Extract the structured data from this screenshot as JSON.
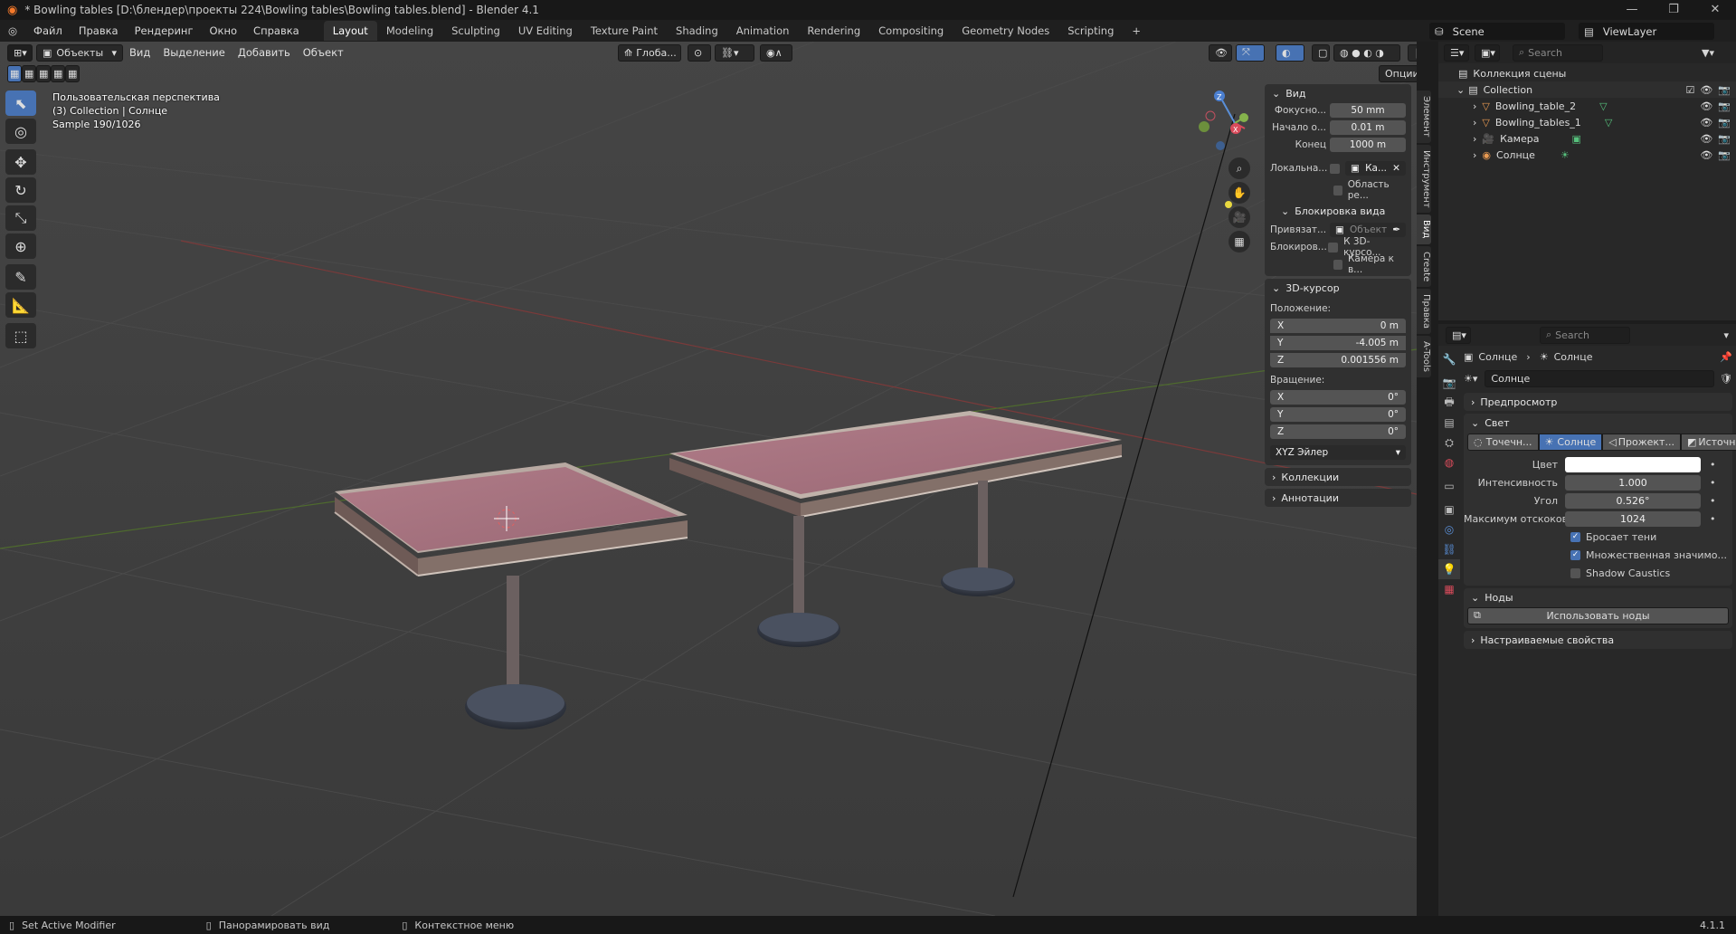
{
  "window": {
    "title": "* Bowling tables [D:\\блендер\\проекты 224\\Bowling tables\\Bowling tables.blend] - Blender 4.1"
  },
  "menu": [
    "Файл",
    "Правка",
    "Рендеринг",
    "Окно",
    "Справка"
  ],
  "workspaces": [
    "Layout",
    "Modeling",
    "Sculpting",
    "UV Editing",
    "Texture Paint",
    "Shading",
    "Animation",
    "Rendering",
    "Compositing",
    "Geometry Nodes",
    "Scripting"
  ],
  "active_workspace": "Layout",
  "scene": {
    "name": "Scene",
    "view_layer": "ViewLayer"
  },
  "viewport_header": {
    "mode": "Объекты",
    "menus": [
      "Вид",
      "Выделение",
      "Добавить",
      "Объект"
    ],
    "transform_orientation": "Глоба...",
    "options_label": "Опции"
  },
  "viewport_info": {
    "line1": "Пользовательская перспектива",
    "line2": "(3) Collection | Солнце",
    "line3": "Sample 190/1026"
  },
  "npanel": {
    "view": {
      "header": "Вид",
      "focal_label": "Фокусно...",
      "focal_value": "50 mm",
      "clip_start_label": "Начало о...",
      "clip_start_value": "0.01 m",
      "clip_end_label": "Конец",
      "clip_end_value": "1000 m",
      "local_camera_label": "Локальна...",
      "local_camera_value": "Ка...",
      "render_region_label": "Область ре...",
      "view_lock_header": "Блокировка вида",
      "lock_to_label": "Привязат...",
      "lock_to_value": "Объект",
      "lock_label": "Блокиров...",
      "lock_cursor_label": "К 3D-курсо...",
      "lock_camera_label": "Камера к в..."
    },
    "cursor": {
      "header": "3D-курсор",
      "location_label": "Положение:",
      "x_label": "X",
      "x": "0 m",
      "y_label": "Y",
      "y": "-4.005 m",
      "z_label": "Z",
      "z": "0.001556 m",
      "rotation_label": "Вращение:",
      "rx_label": "X",
      "rx": "0°",
      "ry_label": "Y",
      "ry": "0°",
      "rz_label": "Z",
      "rz": "0°",
      "rotation_mode": "XYZ Эйлер"
    },
    "collections_header": "Коллекции",
    "annotations_header": "Аннотации",
    "side_tabs": [
      "Элемент",
      "Инструмент",
      "Вид",
      "Create",
      "Правка",
      "A-Tools"
    ]
  },
  "outliner": {
    "search_placeholder": "Search",
    "root": "Коллекция сцены",
    "collection": "Collection",
    "items": [
      "Bowling_table_2",
      "Bowling_tables_1",
      "Камера",
      "Солнце"
    ]
  },
  "properties": {
    "search_placeholder": "Search",
    "breadcrumb_obj": "Солнце",
    "breadcrumb_data": "Солнце",
    "datablock": "Солнце",
    "preview_header": "Предпросмотр",
    "light_header": "Свет",
    "light_types": [
      "Точечн...",
      "Солнце",
      "Прожект...",
      "Источни..."
    ],
    "active_light_type": "Солнце",
    "color_label": "Цвет",
    "color_value": "#ffffff",
    "strength_label": "Интенсивность",
    "strength_value": "1.000",
    "angle_label": "Угол",
    "angle_value": "0.526°",
    "bounces_label": "Максимум отскоков",
    "bounces_value": "1024",
    "cast_shadow": "Бросает тени",
    "mis": "Множественная значимо...",
    "shadow_caustics": "Shadow Caustics",
    "nodes_header": "Ноды",
    "use_nodes": "Использовать ноды",
    "custom_props_header": "Настраиваемые свойства"
  },
  "statusbar": {
    "left": "Set Active Modifier",
    "middle": "Панорамировать вид",
    "right": "Контекстное меню",
    "version": "4.1.1"
  },
  "colors": {
    "accent": "#4772b3",
    "viewport_bg": "#3d3d3d",
    "table_top": "#a67280"
  }
}
